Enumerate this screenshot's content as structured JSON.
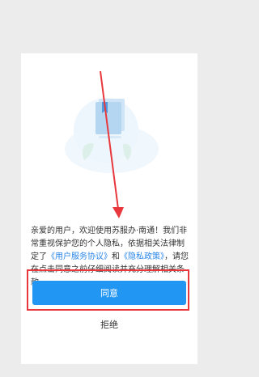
{
  "dialog": {
    "body": {
      "p1": "亲爱的用户，欢迎使用苏服办·南通！我们非常重视保护您的个人隐私，依据相关法律制定了",
      "link_user_agreement": "《用户服务协议》",
      "p2": "和",
      "link_privacy_policy": "《隐私政策》",
      "p3": "，请您在点击同意之前仔细阅读并充分理解相关条款。"
    },
    "agree_label": "同意",
    "refuse_label": "拒绝"
  },
  "colors": {
    "primary": "#2296f3",
    "link": "#2a86e8",
    "annotation": "#e8383d"
  },
  "icons": {
    "illustration": "book-document-illustration"
  }
}
